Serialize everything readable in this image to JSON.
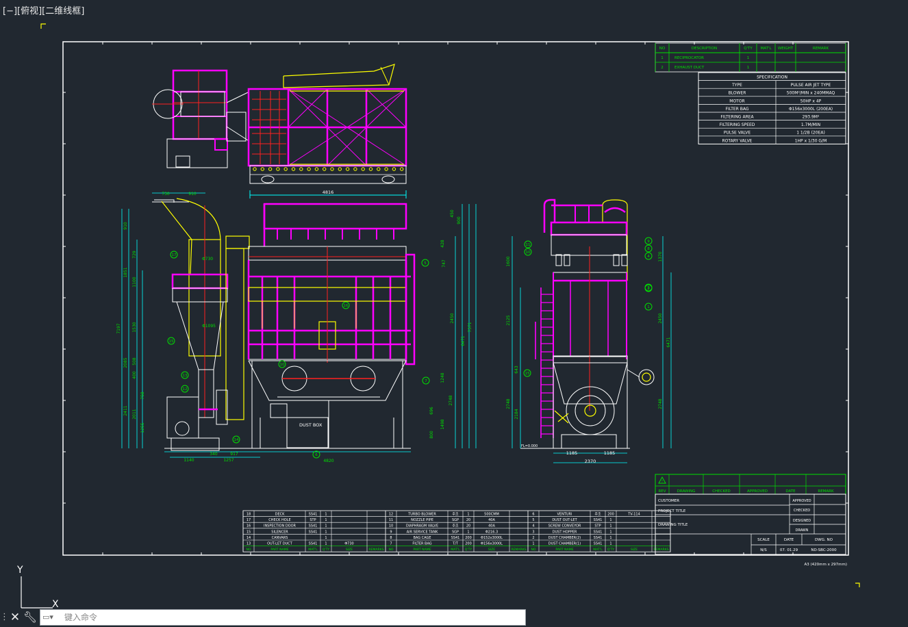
{
  "viewport": {
    "label": "[−][俯视][二维线框]"
  },
  "command_line": {
    "placeholder": "键入命令",
    "close_icon": "close-icon",
    "settings_icon": "wrench-icon"
  },
  "ucs": {
    "y_label": "Y",
    "x_label": "X"
  },
  "colors": {
    "background": "#212830",
    "border": "#ffffff",
    "green": "#00e000",
    "magenta": "#ff00ff",
    "cyan": "#00ffff",
    "yellow": "#ffff00",
    "red": "#ff2020",
    "orange": "#ffd000"
  },
  "parts_table_top": {
    "headers": [
      "NO",
      "DESCRIPTION",
      "Q'TY",
      "MAT'L",
      "WEIGHT",
      "REMARK"
    ],
    "rows": [
      [
        "1",
        "RECIPROCATOR",
        "1",
        "",
        "",
        ""
      ],
      [
        "2",
        "EXHAUST DUCT",
        "1",
        "",
        "",
        ""
      ]
    ]
  },
  "specification": {
    "title": "SPECIFICATION",
    "rows": [
      [
        "TYPE",
        "PULSE AIR JET TYPE"
      ],
      [
        "BLOWER",
        "500M³/MIN x 240MMAQ"
      ],
      [
        "MOTOR",
        "50HP x 4P"
      ],
      [
        "FILTER BAG",
        "Φ156x3000L (200EA)"
      ],
      [
        "FILTERING AREA",
        "293.9M²"
      ],
      [
        "FILTERING SPEED",
        "1.7M/MIN"
      ],
      [
        "PULSE VALVE",
        "1 1/2B (20EA)"
      ],
      [
        "ROTARY VALVE",
        "1HP x 1/30 G/M"
      ]
    ]
  },
  "dimensions": {
    "top_width": "4816",
    "front_left": [
      "730",
      "910"
    ],
    "front_verticals": [
      "910",
      "1851",
      "7197",
      "729",
      "1100",
      "1530",
      "2085",
      "508",
      "400",
      "758",
      "2411",
      "2011",
      "1255"
    ],
    "front_bottom": [
      "1140",
      "1257",
      "340",
      "917",
      "4820"
    ],
    "front_right": [
      "450",
      "900",
      "428",
      "747",
      "2450",
      "7371",
      "1248",
      "6471",
      "696",
      "1498",
      "800",
      "2748"
    ],
    "front_labels": [
      "Φ730",
      "Φ1095"
    ],
    "side_left": [
      "1600",
      "2125",
      "643",
      "2748",
      "2184"
    ],
    "side_right": [
      "1370",
      "2450",
      "6471",
      "2748"
    ],
    "side_bottom": [
      "1185",
      "1185",
      "2370"
    ],
    "side_level": "FL=0.000",
    "dust_box": "DUST BOX"
  },
  "balloons": {
    "front": [
      "17",
      "16",
      "15",
      "13",
      "12",
      "14",
      "6",
      "5",
      "10",
      "7"
    ],
    "side": [
      "11",
      "10",
      "9",
      "8",
      "4",
      "2",
      "1",
      "3",
      "15"
    ]
  },
  "parts_list": {
    "header": [
      "NO",
      "PART NAME",
      "MAT'L",
      "Q'TY",
      "SIZE",
      "REMARKS"
    ],
    "col1": [
      [
        "18",
        "DECK",
        "SS41",
        "1",
        "",
        ""
      ],
      [
        "17",
        "CHECK HOLE",
        "STP",
        "1",
        "",
        ""
      ],
      [
        "16",
        "INSPECTION DOOR",
        "SS41",
        "1",
        "",
        ""
      ],
      [
        "15",
        "SILENCER",
        "SS41",
        "1",
        "",
        ""
      ],
      [
        "14",
        "CANVARS",
        "",
        "1",
        "",
        ""
      ],
      [
        "13",
        "OUT-LET DUCT",
        "SS41",
        "1",
        "Φ730",
        ""
      ]
    ],
    "col2": [
      [
        "12",
        "TURBO BLOWER",
        "주조",
        "1",
        "500CMM",
        ""
      ],
      [
        "11",
        "NOZZLE PIPE",
        "SGP",
        "20",
        "40A",
        ""
      ],
      [
        "10",
        "DIAPHRAGM VALVE",
        "주조",
        "20",
        "40A",
        ""
      ],
      [
        "9",
        "AIR SERVICE TANK",
        "SGP",
        "1",
        "Φ216.3",
        ""
      ],
      [
        "8",
        "BAG CAGE",
        "SS41",
        "200",
        "Φ152x3000L",
        ""
      ],
      [
        "7",
        "FILTER BAG",
        "T/T",
        "200",
        "Φ156x3000L",
        ""
      ]
    ],
    "col3": [
      [
        "6",
        "VENTURI",
        "주조",
        "200",
        "TV-114",
        ""
      ],
      [
        "5",
        "DUST OUT-LET",
        "SS41",
        "1",
        "",
        ""
      ],
      [
        "4",
        "SCREW CONVEYOR",
        "STP",
        "1",
        "",
        ""
      ],
      [
        "3",
        "DUST HOPPER",
        "SS41",
        "1",
        "",
        ""
      ],
      [
        "2",
        "DUST CHAMBER(2)",
        "SS41",
        "1",
        "",
        ""
      ],
      [
        "1",
        "DUST CHAMBER(1)",
        "SS41",
        "1",
        "",
        ""
      ]
    ]
  },
  "revision_block": {
    "symbol": "!",
    "headers": [
      "REV",
      "DRAWING",
      "CHECKED",
      "APPROVED",
      "DATE",
      "REMARK"
    ]
  },
  "title_block": {
    "customer_label": "CUSTOMER",
    "project_label": "PROJECT TITLE",
    "drawing_label": "DRAWING TITLE",
    "approved": "APPROVED",
    "checked": "CHECKED",
    "designed": "DESIGNED",
    "drawn": "DRAWN",
    "scale_label": "SCALE",
    "date_label": "DATE",
    "dwg_label": "DWG. NO",
    "scale": "N/S",
    "date": "07. 01.29",
    "dwg_no": "ND-SBC-2000",
    "sheet_note": "A3 (420mm x 297mm)"
  }
}
